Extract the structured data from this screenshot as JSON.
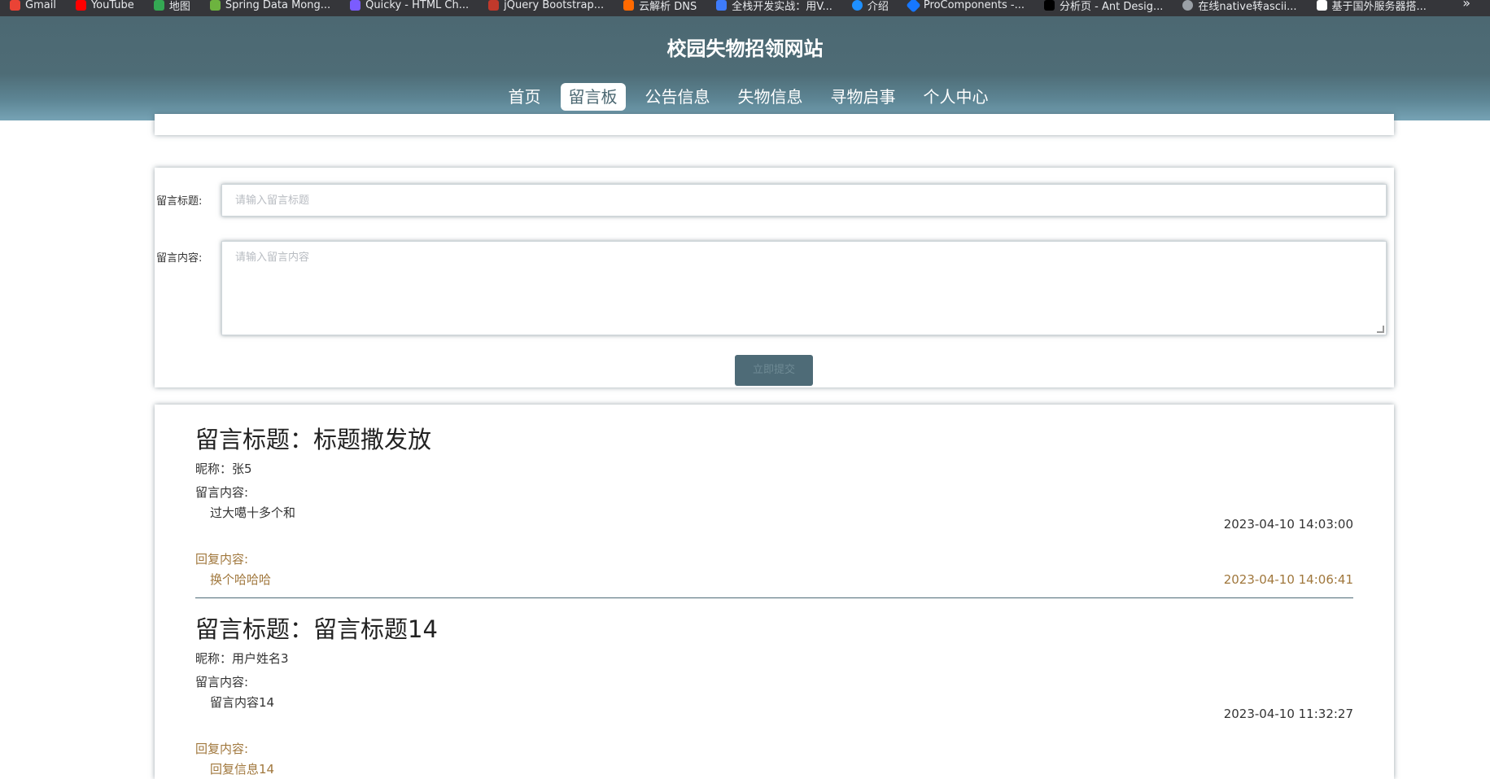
{
  "bookmarks": {
    "items": [
      {
        "label": "Gmail",
        "color": "#ea4335"
      },
      {
        "label": "YouTube",
        "color": "#ff0000"
      },
      {
        "label": "地图",
        "color": "#34a853"
      },
      {
        "label": "Spring Data Mong...",
        "color": "#6db33f"
      },
      {
        "label": "Quicky - HTML Ch...",
        "color": "#7b5cff"
      },
      {
        "label": "jQuery Bootstrap...",
        "color": "#c0392b"
      },
      {
        "label": "云解析 DNS",
        "color": "#ff6a00"
      },
      {
        "label": "全栈开发实战：用V...",
        "color": "#3e7bfa"
      },
      {
        "label": "介绍",
        "color": "#1e90ff"
      },
      {
        "label": "ProComponents -...",
        "color": "#1677ff"
      },
      {
        "label": "分析页 - Ant Desig...",
        "color": "#222222"
      },
      {
        "label": "在线native转ascii...",
        "color": "#9aa0a6"
      },
      {
        "label": "基于国外服务器搭...",
        "color": "#ffffff"
      }
    ],
    "more_icon": "»"
  },
  "header": {
    "site_title": "校园失物招领网站",
    "nav": [
      {
        "label": "首页",
        "active": false
      },
      {
        "label": "留言板",
        "active": true
      },
      {
        "label": "公告信息",
        "active": false
      },
      {
        "label": "失物信息",
        "active": false
      },
      {
        "label": "寻物启事",
        "active": false
      },
      {
        "label": "个人中心",
        "active": false
      }
    ]
  },
  "form": {
    "title_label": "留言标题:",
    "title_placeholder": "请输入留言标题",
    "content_label": "留言内容:",
    "content_placeholder": "请输入留言内容",
    "submit_label": "立即提交"
  },
  "messages": [
    {
      "title": "留言标题：标题撒发放",
      "nickname": "昵称：张5",
      "content_label": "留言内容:",
      "content": "过大噶十多个和",
      "time": "2023-04-10 14:03:00",
      "reply_label": "回复内容:",
      "reply": "换个哈哈哈",
      "reply_time": "2023-04-10 14:06:41"
    },
    {
      "title": "留言标题：留言标题14",
      "nickname": "昵称：用户姓名3",
      "content_label": "留言内容:",
      "content": "留言内容14",
      "time": "2023-04-10 11:32:27",
      "reply_label": "回复内容:",
      "reply": "回复信息14"
    }
  ],
  "colors": {
    "header_bg": "#4c6872",
    "accent": "#4e6b77",
    "reply_text": "#a0773c"
  }
}
